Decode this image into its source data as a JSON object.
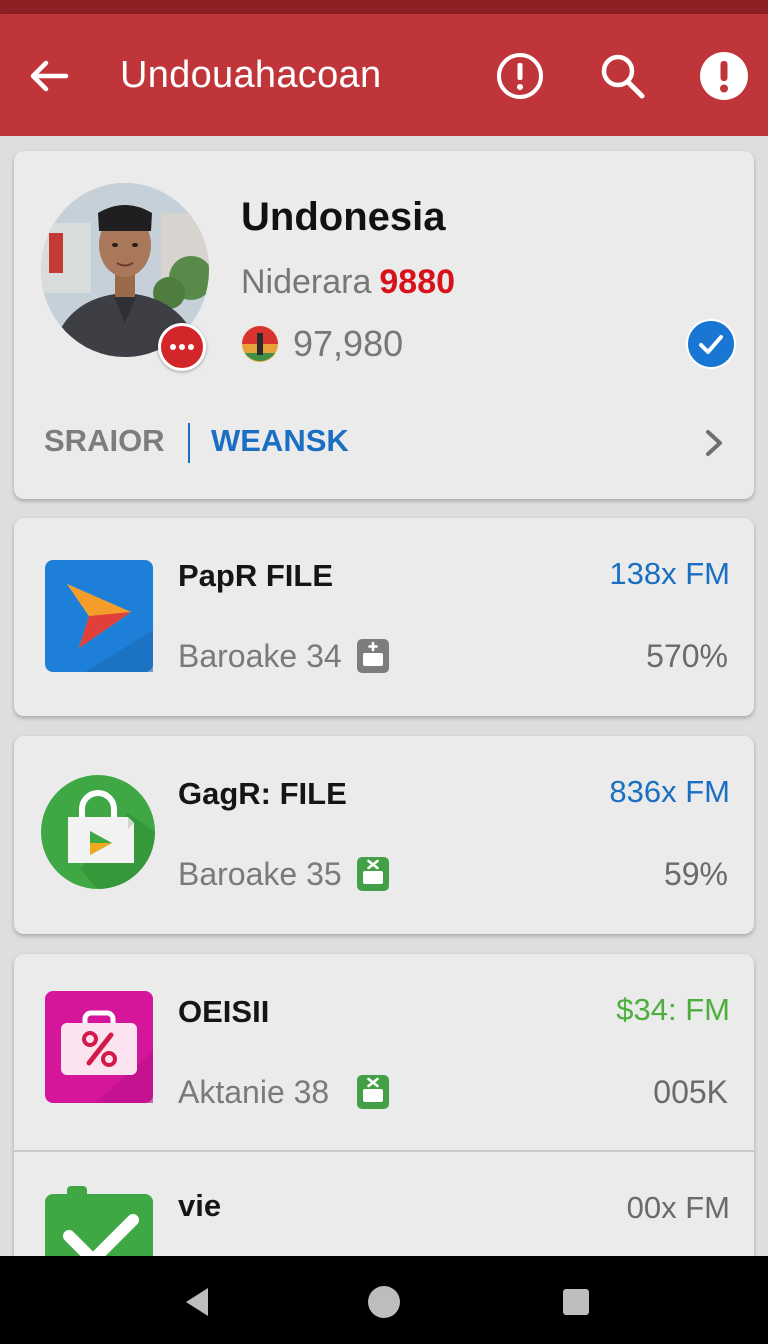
{
  "appbar": {
    "title": "Undouahacoan",
    "back_icon": "arrow-left-icon",
    "info_icon": "info-circle-icon",
    "search_icon": "search-icon",
    "alert_icon": "alert-circle-icon",
    "color": "#c0353a"
  },
  "profile": {
    "name": "Undonesia",
    "sub_label": "Niderara",
    "sub_value": "9880",
    "coin_value": "97,980",
    "verified": true,
    "tabs": [
      {
        "label": "SRAIOR",
        "active": false
      },
      {
        "label": "WEANSK",
        "active": true
      }
    ]
  },
  "items": [
    {
      "title": "PapR FILE",
      "subtitle": "Baroake 34",
      "price": "138x FM",
      "price_color": "#1a6fc2",
      "percent": "570%",
      "icon": "paper-plane-app-icon"
    },
    {
      "title": "GagR: FILE",
      "subtitle": "Baroake 35",
      "price": "836x FM",
      "price_color": "#1a6fc2",
      "percent": "59%",
      "icon": "shopping-bag-play-app-icon"
    },
    {
      "title": "OEISII",
      "subtitle": "Aktanie 38",
      "price": "$34: FM",
      "price_color": "#4caf3c",
      "percent": "005K",
      "icon": "discount-bag-app-icon"
    },
    {
      "title": "vie",
      "price": "00x FM",
      "price_color": "#6a6a6a",
      "icon": "check-app-icon"
    }
  ],
  "navbar": {
    "back_icon": "nav-back-icon",
    "home_icon": "nav-home-icon",
    "recents_icon": "nav-recents-icon"
  }
}
